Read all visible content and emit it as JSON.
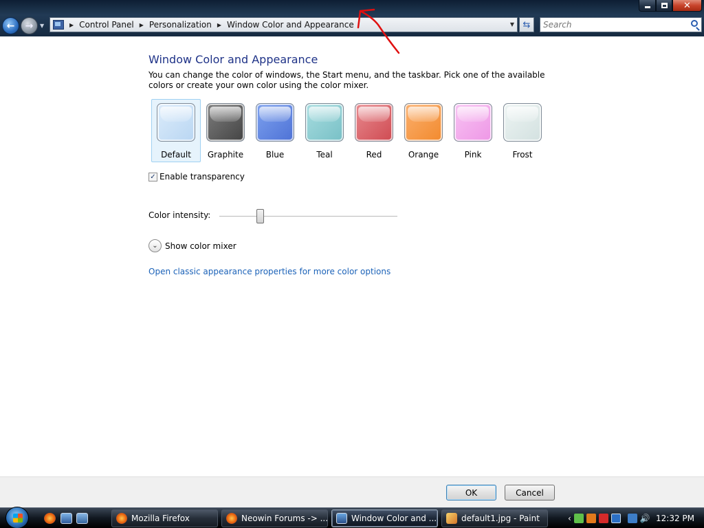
{
  "window": {
    "controls": {
      "minimize": "minimize",
      "maximize": "maximize",
      "close": "✕"
    }
  },
  "navbar": {
    "back_glyph": "←",
    "forward_glyph": "→",
    "breadcrumb": [
      "Control Panel",
      "Personalization",
      "Window Color and Appearance"
    ],
    "search_placeholder": "Search"
  },
  "main": {
    "heading": "Window Color and Appearance",
    "description": "You can change the color of windows, the Start menu, and the taskbar. Pick one of the available colors or create your own color using the color mixer.",
    "swatches": [
      {
        "name": "Default",
        "color": "#dcecfb",
        "dark": "#b9d6f2",
        "selected": true
      },
      {
        "name": "Graphite",
        "color": "#7e7e7e",
        "dark": "#444444",
        "selected": false
      },
      {
        "name": "Blue",
        "color": "#7ea2ef",
        "dark": "#4e72d6",
        "selected": false
      },
      {
        "name": "Teal",
        "color": "#a8dde0",
        "dark": "#78c0c6",
        "selected": false
      },
      {
        "name": "Red",
        "color": "#e88a8f",
        "dark": "#cf4b52",
        "selected": false
      },
      {
        "name": "Orange",
        "color": "#fbb06e",
        "dark": "#f28a2e",
        "selected": false
      },
      {
        "name": "Pink",
        "color": "#f8c3f3",
        "dark": "#ee97e6",
        "selected": false
      },
      {
        "name": "Frost",
        "color": "#edf4f3",
        "dark": "#d3e1e0",
        "selected": false
      }
    ],
    "enable_transparency": {
      "label": "Enable transparency",
      "checked": true,
      "check_glyph": "✓"
    },
    "color_intensity": {
      "label": "Color intensity:",
      "level": 0.23
    },
    "color_mixer": {
      "label": "Show color mixer",
      "glyph": "⌄"
    },
    "classic_link": "Open classic appearance properties for more color options"
  },
  "buttons": {
    "ok": "OK",
    "cancel": "Cancel"
  },
  "taskbar": {
    "tasks": [
      {
        "label": "Mozilla Firefox",
        "icon": "firefox-icon",
        "active": false
      },
      {
        "label": "Neowin Forums -> ...",
        "icon": "firefox-icon",
        "active": false
      },
      {
        "label": "Window Color and ...",
        "icon": "window-icon",
        "active": true
      },
      {
        "label": "default1.jpg - Paint",
        "icon": "paint-icon",
        "active": false
      }
    ],
    "tray_chevron": "‹",
    "clock": "12:32 PM"
  }
}
